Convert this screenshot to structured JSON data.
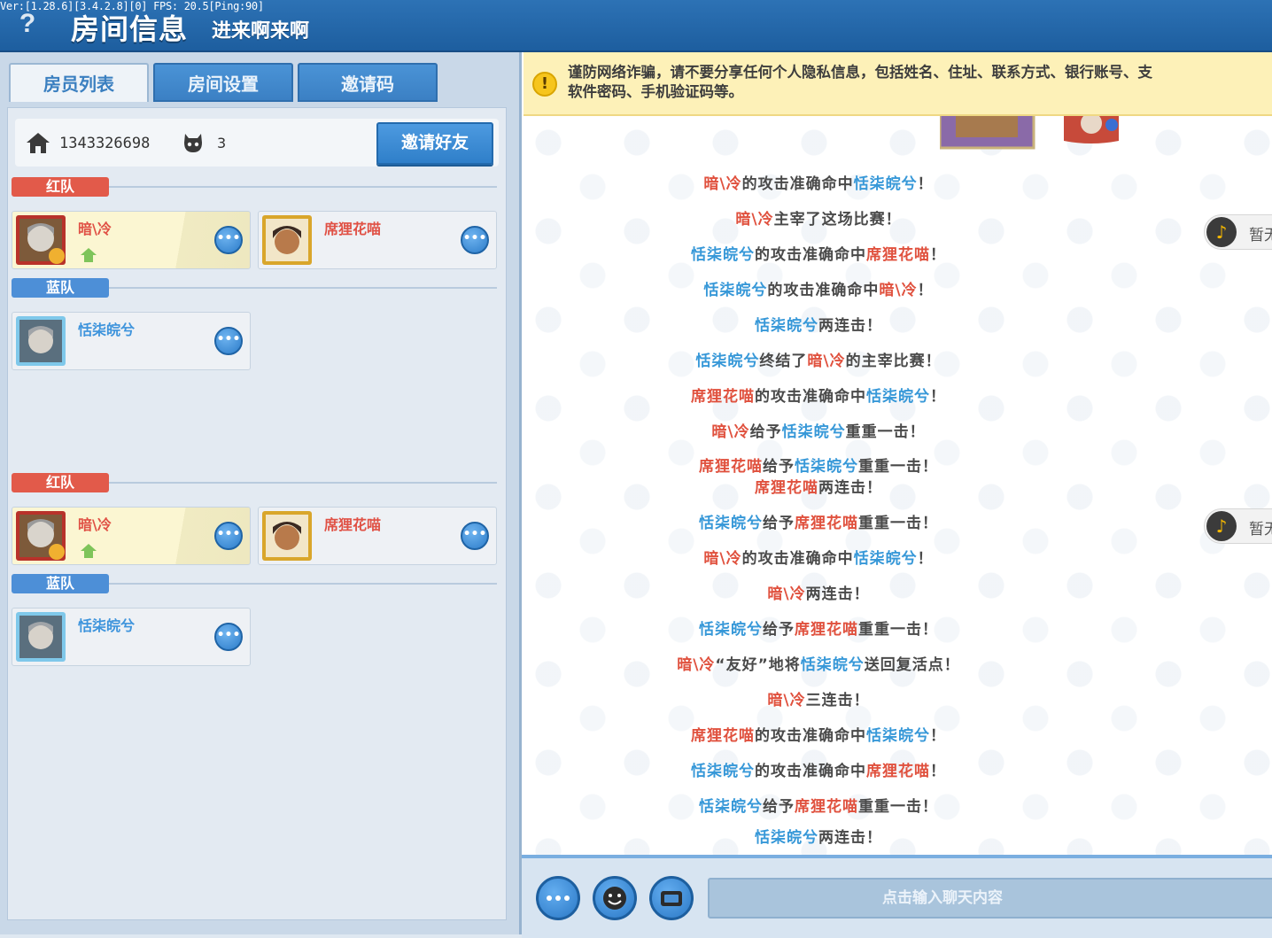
{
  "header": {
    "version": "Ver:[1.28.6][3.4.2.8][0] FPS: 20.5[Ping:90]",
    "title": "房间信息",
    "room_name": "进来啊来啊"
  },
  "tabs": [
    {
      "label": "房员列表",
      "active": true
    },
    {
      "label": "房间设置",
      "active": false
    },
    {
      "label": "邀请码",
      "active": false
    }
  ],
  "room": {
    "id": "1343326698",
    "member_count": "3",
    "invite_label": "邀请好友"
  },
  "teams_block_1": {
    "red_label": "红队",
    "blue_label": "蓝队",
    "red_players": [
      {
        "name": "暗\\冷",
        "host": true,
        "is_me": true
      },
      {
        "name": "席狸花喵",
        "host": false,
        "is_me": false
      }
    ],
    "blue_players": [
      {
        "name": "恬柒皖兮",
        "host": false,
        "is_me": false
      }
    ]
  },
  "teams_block_2": {
    "red_label": "红队",
    "blue_label": "蓝队",
    "red_players": [
      {
        "name": "暗\\冷",
        "host": true,
        "is_me": true
      },
      {
        "name": "席狸花喵",
        "host": false,
        "is_me": false
      }
    ],
    "blue_players": [
      {
        "name": "恬柒皖兮",
        "host": false,
        "is_me": false
      }
    ]
  },
  "more_button_label": "•••",
  "notice": {
    "icon": "!",
    "line1": "谨防网络诈骗，请不要分享任何个人隐私信息，包括姓名、住址、联系方式、银行账号、支",
    "line2": "软件密码、手机验证码等。"
  },
  "chat_messages": [
    [
      {
        "t": "暗\\冷",
        "c": "r"
      },
      {
        "t": "的攻击准确命中"
      },
      {
        "t": "恬柒皖兮",
        "c": "b"
      },
      {
        "t": "！"
      }
    ],
    [
      {
        "t": "暗\\冷",
        "c": "r"
      },
      {
        "t": "主宰了这场比赛！"
      }
    ],
    [
      {
        "t": "恬柒皖兮",
        "c": "b"
      },
      {
        "t": "的攻击准确命中"
      },
      {
        "t": "席狸花喵",
        "c": "r"
      },
      {
        "t": "！"
      }
    ],
    [
      {
        "t": "恬柒皖兮",
        "c": "b"
      },
      {
        "t": "的攻击准确命中"
      },
      {
        "t": "暗\\冷",
        "c": "r"
      },
      {
        "t": "！"
      }
    ],
    [
      {
        "t": "恬柒皖兮",
        "c": "b"
      },
      {
        "t": "两连击！"
      }
    ],
    [
      {
        "t": "恬柒皖兮",
        "c": "b"
      },
      {
        "t": "终结了"
      },
      {
        "t": "暗\\冷",
        "c": "r"
      },
      {
        "t": "的主宰比赛！"
      }
    ],
    [
      {
        "t": "席狸花喵",
        "c": "r"
      },
      {
        "t": "的攻击准确命中"
      },
      {
        "t": "恬柒皖兮",
        "c": "b"
      },
      {
        "t": "！"
      }
    ],
    [
      {
        "t": "暗\\冷",
        "c": "r"
      },
      {
        "t": "给予"
      },
      {
        "t": "恬柒皖兮",
        "c": "b"
      },
      {
        "t": "重重一击！"
      }
    ],
    [
      {
        "t": "席狸花喵",
        "c": "r"
      },
      {
        "t": "给予"
      },
      {
        "t": "恬柒皖兮",
        "c": "b"
      },
      {
        "t": "重重一击！"
      }
    ],
    [
      {
        "t": "席狸花喵",
        "c": "r"
      },
      {
        "t": "两连击！"
      }
    ],
    [
      {
        "t": "恬柒皖兮",
        "c": "b"
      },
      {
        "t": "给予"
      },
      {
        "t": "席狸花喵",
        "c": "r"
      },
      {
        "t": "重重一击！"
      }
    ],
    [
      {
        "t": "暗\\冷",
        "c": "r"
      },
      {
        "t": "的攻击准确命中"
      },
      {
        "t": "恬柒皖兮",
        "c": "b"
      },
      {
        "t": "！"
      }
    ],
    [
      {
        "t": "暗\\冷",
        "c": "r"
      },
      {
        "t": "两连击！"
      }
    ],
    [
      {
        "t": "恬柒皖兮",
        "c": "b"
      },
      {
        "t": "给予"
      },
      {
        "t": "席狸花喵",
        "c": "r"
      },
      {
        "t": "重重一击！"
      }
    ],
    [
      {
        "t": "暗\\冷",
        "c": "r"
      },
      {
        "t": "“友好”地将"
      },
      {
        "t": "恬柒皖兮",
        "c": "b"
      },
      {
        "t": "送回复活点！"
      }
    ],
    [
      {
        "t": "暗\\冷",
        "c": "r"
      },
      {
        "t": "三连击！"
      }
    ],
    [
      {
        "t": "席狸花喵",
        "c": "r"
      },
      {
        "t": "的攻击准确命中"
      },
      {
        "t": "恬柒皖兮",
        "c": "b"
      },
      {
        "t": "！"
      }
    ],
    [
      {
        "t": "恬柒皖兮",
        "c": "b"
      },
      {
        "t": "的攻击准确命中"
      },
      {
        "t": "席狸花喵",
        "c": "r"
      },
      {
        "t": "！"
      }
    ],
    [
      {
        "t": "恬柒皖兮",
        "c": "b"
      },
      {
        "t": "给予"
      },
      {
        "t": "席狸花喵",
        "c": "r"
      },
      {
        "t": "重重一击！"
      }
    ],
    [
      {
        "t": "恬柒皖兮",
        "c": "b"
      },
      {
        "t": "两连击！"
      }
    ]
  ],
  "music_pill_label": "暂无",
  "chat_input_placeholder": "点击输入聊天内容",
  "icons": {
    "help": "help-icon",
    "home": "home-icon",
    "members": "members-icon",
    "host": "host-icon",
    "more": "more-icon",
    "warning": "warning-icon",
    "music": "music-note-icon",
    "emoji": "emoji-icon",
    "keyboard": "keyboard-icon"
  },
  "colors": {
    "red_team": "#e05145",
    "blue_team": "#3798d8",
    "accent": "#2f7fc9"
  }
}
